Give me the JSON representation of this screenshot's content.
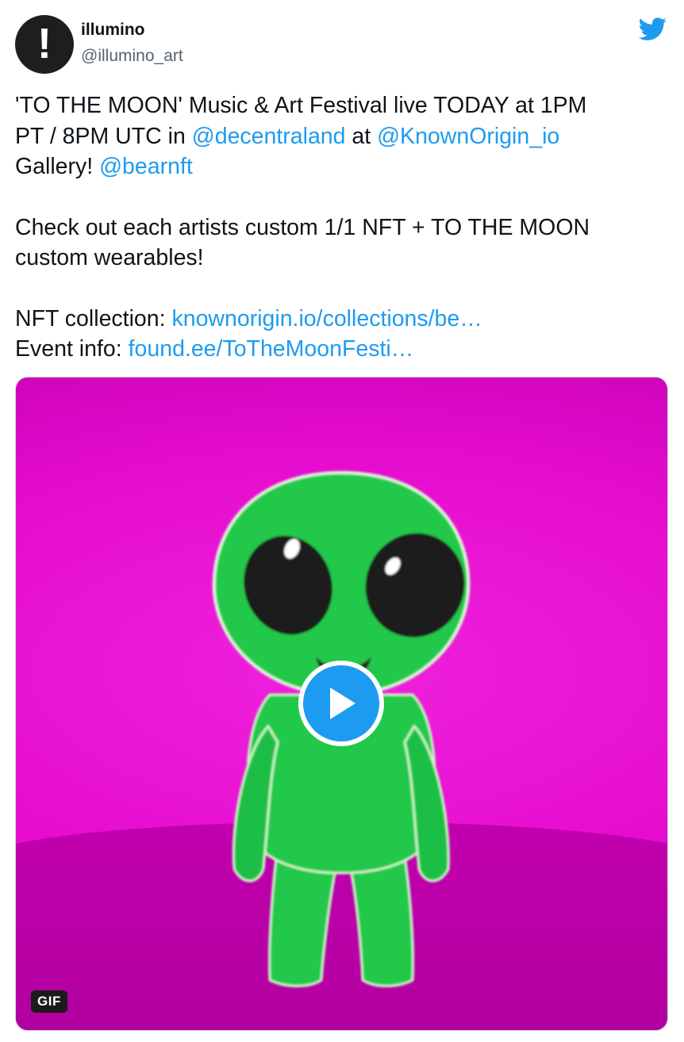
{
  "author": {
    "display_name": "illumino",
    "handle": "@illumino_art",
    "avatar_glyph": "!"
  },
  "brand_icon": "twitter-bird-icon",
  "colors": {
    "link": "#1d9bf0",
    "text": "#0f1419",
    "secondary": "#536471",
    "media_bg": "#e60ccf",
    "alien": "#22c84a"
  },
  "tweet": {
    "line1": "'TO THE MOON' Music & Art Festival live TODAY at 1PM",
    "line2_a": "PT / 8PM UTC in ",
    "mention_decentraland": "@decentraland",
    "line2_b": " at ",
    "mention_knownorigin": "@KnownOrigin_io",
    "line3_a": "Gallery! ",
    "mention_bearnft": "@bearnft",
    "line4": "Check out each artists custom 1/1 NFT + TO THE MOON",
    "line5": "custom wearables!",
    "nft_label": "NFT collection: ",
    "nft_link": "knownorigin.io/collections/be…",
    "event_label": "Event info: ",
    "event_link": "found.ee/ToTheMoonFesti…"
  },
  "media": {
    "badge": "GIF",
    "play_icon": "play-icon"
  }
}
